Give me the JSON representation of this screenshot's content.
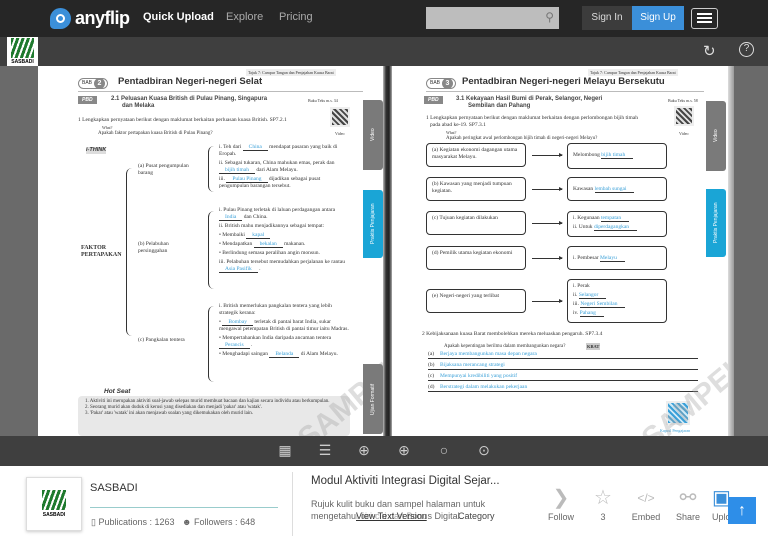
{
  "nav": {
    "brand": "anyflip",
    "links": [
      "Quick Upload",
      "Explore",
      "Pricing"
    ],
    "search_placeholder": "",
    "sign_in": "Sign In",
    "sign_up": "Sign Up"
  },
  "toolbar": {
    "publisher_logo": "SASBADI"
  },
  "left_page": {
    "header_note": "Tajuk 7: Campur Tangan dan Penjajahan Kuasa Barat",
    "bab_label": "BAB",
    "bab_number": "2",
    "chapter_title": "Pentadbiran Negeri-negeri Selat",
    "pbd": "PBD",
    "section": "2.1 Peluasan Kuasa British di Pulau Pinang, Singapura",
    "section_2": "dan Melaka",
    "ref": "Buku Teks m.s. 34",
    "q1": "1  Lengkapkan pernyataan berikut dengan maklumat berkaitan perluasan kuasa British. SP7.2.1",
    "what": "What?",
    "what_q": "Apakah faktor pertapakan kuasa British di Pulau Pinang?",
    "video": "Video",
    "ithink": "i-THINK",
    "faktor": "FAKTOR",
    "pertapakan": "PERTAPAKAN",
    "a_label": "(a)  Pusat pengumpulan barang",
    "b_label": "(b)  Pelabuhan persinggahan",
    "c_label": "(c)  Pangkalan tentera",
    "a_items": [
      {
        "pre": "i.   Teh dari",
        "ans": "China",
        "post": "mendapat pasaran yang baik di Eropah."
      },
      {
        "pre": "ii.  Sebagai tukaran, China mahukan emas, perak dan",
        "ans": "bijih timah",
        "post": "dari Alam Melayu."
      },
      {
        "pre": "iii.",
        "ans": "Pulau Pinang",
        "post": "dijadikan sebagai pusat pengumpulan barangan tersebut."
      }
    ],
    "b_items": [
      {
        "pre": "i.   Pulau Pinang terletak di laluan perdagangan antara",
        "ans": "India",
        "post": "dan China."
      },
      {
        "pre": "ii.  British mahu menjadikannya sebagai tempat:",
        "ans": "",
        "post": ""
      },
      {
        "pre": "•  Membaiki",
        "ans": "kapal",
        "post": ""
      },
      {
        "pre": "•  Mendapatkan",
        "ans": "bekalan",
        "post": "makanan."
      },
      {
        "pre": "•  Berlindung semasa peralihan angin monsun.",
        "ans": "",
        "post": ""
      },
      {
        "pre": "iii. Pelabuhan tersebut memudahkan perjalanan ke rantau",
        "ans": "Asia Pasifik",
        "post": "."
      }
    ],
    "c_items": [
      {
        "pre": "i.   British memerlukan pangkalan tentera yang lebih strategik kerana:",
        "ans": "",
        "post": ""
      },
      {
        "pre": "•",
        "ans": "Bombay",
        "post": "terletak di pantai barat India, sukar mengawal petempatan British di pantai timur iaitu Madras."
      },
      {
        "pre": "•  Mempertahankan India daripada ancaman tentera",
        "ans": "Perancis",
        "post": "."
      },
      {
        "pre": "•  Menghadapi saingan",
        "ans": "Belanda",
        "post": "di Alam Melayu."
      }
    ],
    "hot_seat": "Hot Seat",
    "hot_items": [
      "1.  Aktiviti ini merupakan aktiviti soal-jawab selepas murid membuat bacaan dan kajian secara individu atau berkumpulan.",
      "2.  Seorang murid akan duduk di kerusi yang disediakan dan menjadi 'pakar' atau 'watak'.",
      "3.  'Pakar' atau 'watak' ini akan menjawab soalan yang dikemukakan oleh murid lain."
    ],
    "tabs": [
      "Video",
      "Praktis Penjajaran",
      "Ujian Formatif"
    ],
    "watermark": "SAMPEL"
  },
  "right_page": {
    "header_note": "Tajuk 7: Campur Tangan dan Penjajahan Kuasa Barat",
    "bab_label": "BAB",
    "bab_number": "3",
    "chapter_title": "Pentadbiran Negeri-negeri Melayu Bersekutu",
    "pbd": "PBD",
    "section": "3.1 Kekayaan Hasil Bumi di Perak, Selangor, Negeri",
    "section_2": "Sembilan dan Pahang",
    "ref": "Buku Teks m.s. 58",
    "q1": "1  Lengkapkan pernyataan berikut dengan maklumat berkaitan dengan perlombongan bijih timah",
    "q1b": "pada abad ke-19. SP7.3.1",
    "what": "What?",
    "what_q": "Apakah peringkat awal perlombongan bijih timah di negeri-negeri Melayu?",
    "video": "Video",
    "rows": [
      {
        "left": "(a)  Kegiatan ekonomi dagangan utama masyarakat Melayu.",
        "right": [
          {
            "pre": "Melombong",
            "ans": "bijih timah"
          }
        ]
      },
      {
        "left": "(b)  Kawasan yang menjadi tumpuan kegiatan.",
        "right": [
          {
            "pre": "Kawasan",
            "ans": "lembah sungai"
          }
        ]
      },
      {
        "left": "(c)  Tujuan kegiatan dilakukan",
        "right": [
          {
            "pre": "i.    Kegunaan",
            "ans": "tempatan"
          },
          {
            "pre": "ii.   Untuk",
            "ans": "diperdagangkan"
          }
        ]
      },
      {
        "left": "(d)  Pemilik utama kegiatan ekonomi",
        "right": [
          {
            "pre": "i.    Pembesar",
            "ans": "Melayu"
          }
        ]
      },
      {
        "left": "(e)  Negeri-negeri yang terlibat",
        "right": [
          {
            "pre": "i.    Perak",
            "ans": ""
          },
          {
            "pre": "ii.",
            "ans": "Selangor"
          },
          {
            "pre": "iii.",
            "ans": "Negeri Sembilan"
          },
          {
            "pre": "iv.",
            "ans": "Pahang"
          }
        ]
      }
    ],
    "q2": "2  Kebijaksanaan kuasa Barat membolehkan mereka meluaskan pengaruh. SP7.3.4",
    "q2_what": "Apakah kepentingan berilmu dalam membangunkan negara?",
    "kbat": "KBAT",
    "q2_answers": [
      {
        "label": "(a)",
        "ans": "Berjaya membangunkan masa depan negara"
      },
      {
        "label": "(b)",
        "ans": "Bijaksana merancang strategi"
      },
      {
        "label": "(c)",
        "ans": "Mempunyai kredibiliti yang positif"
      },
      {
        "label": "(d)",
        "ans": "Berstrategi dalam melakukan pekerjaan"
      }
    ],
    "qr_label": "Kapsul Pengajaran",
    "tabs": [
      "Video",
      "Praktis Penjajaran"
    ],
    "watermark": "SAMPEL"
  },
  "bottom_toolbar": [
    "thumbnails-icon",
    "table-of-contents-icon",
    "auto-flip-icon",
    "zoom-in-icon",
    "search-icon",
    "more-icon"
  ],
  "info": {
    "publisher": "SASBADI",
    "publications_label": "Publications : ",
    "publications": "1263",
    "followers_label": "Followers : ",
    "followers": "648",
    "title": "Modul Aktiviti Integrasi Digital Sejar...",
    "desc_1": "Rujuk kulit buku dan sampel halaman untuk",
    "desc_2": "mengetahui ciri-ciri dan Bonus Digital.",
    "view_text": "View Text Version",
    "category": "Category",
    "actions": [
      {
        "label": "Follow"
      },
      {
        "label": "3"
      },
      {
        "label": "Embed"
      },
      {
        "label": "Share"
      },
      {
        "label": "Upload"
      }
    ]
  },
  "colors": {
    "accent": "#3b8fd9",
    "answer": "#3aa0d8",
    "nav": "#262626"
  }
}
